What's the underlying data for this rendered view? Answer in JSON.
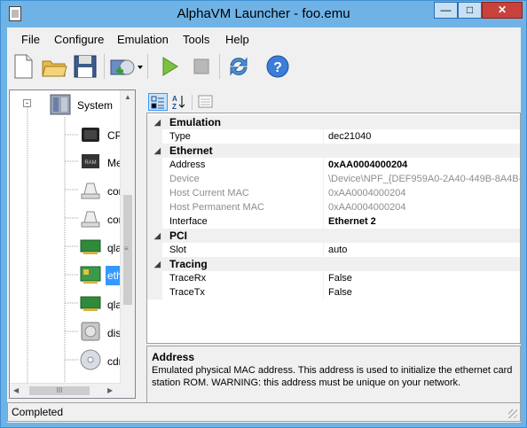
{
  "window": {
    "title": "AlphaVM Launcher - foo.emu",
    "min_glyph": "—",
    "max_glyph": "□",
    "close_glyph": "✕"
  },
  "menu": [
    "File",
    "Configure",
    "Emulation",
    "Tools",
    "Help"
  ],
  "toolbar": {
    "icons": [
      "new-file-icon",
      "open-folder-icon",
      "save-icon",
      "add-device-icon",
      "run-icon",
      "stop-icon",
      "refresh-icon",
      "help-icon"
    ]
  },
  "tree": {
    "root_label": "System",
    "items": [
      {
        "label": "CP",
        "icon": "cpu-icon"
      },
      {
        "label": "Me",
        "icon": "memory-icon"
      },
      {
        "label": "cor",
        "icon": "console-port-icon"
      },
      {
        "label": "cor",
        "icon": "console-port-icon"
      },
      {
        "label": "qla",
        "icon": "pci-card-icon"
      },
      {
        "label": "eth",
        "icon": "network-card-icon",
        "selected": true
      },
      {
        "label": "qla",
        "icon": "pci-card-icon"
      },
      {
        "label": "disl",
        "icon": "disk-icon"
      },
      {
        "label": "cdr",
        "icon": "cdrom-icon"
      }
    ],
    "hscroll_glyph": "III",
    "vscroll_glyph": "≡"
  },
  "property_grid": {
    "rows": [
      {
        "type": "cat",
        "name": "Emulation"
      },
      {
        "type": "prop",
        "name": "Type",
        "value": "dec21040"
      },
      {
        "type": "cat",
        "name": "Ethernet"
      },
      {
        "type": "prop",
        "name": "Address",
        "value": "0xAA0004000204",
        "bold": true
      },
      {
        "type": "prop",
        "name": "Device",
        "value": "\\Device\\NPF_{DEF959A0-2A40-449B-8A4B-",
        "dim": true
      },
      {
        "type": "prop",
        "name": "Host Current MAC",
        "value": "0xAA0004000204",
        "dim": true
      },
      {
        "type": "prop",
        "name": "Host Permanent MAC",
        "value": "0xAA0004000204",
        "dim": true
      },
      {
        "type": "prop",
        "name": "Interface",
        "value": "Ethernet 2",
        "bold": true
      },
      {
        "type": "cat",
        "name": "PCI"
      },
      {
        "type": "prop",
        "name": "Slot",
        "value": "auto"
      },
      {
        "type": "cat",
        "name": "Tracing"
      },
      {
        "type": "prop",
        "name": "TraceRx",
        "value": "False"
      },
      {
        "type": "prop",
        "name": "TraceTx",
        "value": "False"
      }
    ]
  },
  "description": {
    "title": "Address",
    "text": "Emulated physical MAC address. This address is used to initialize the ethernet card station ROM. WARNING: this address must be unique on your network."
  },
  "status": {
    "text": "Completed"
  }
}
